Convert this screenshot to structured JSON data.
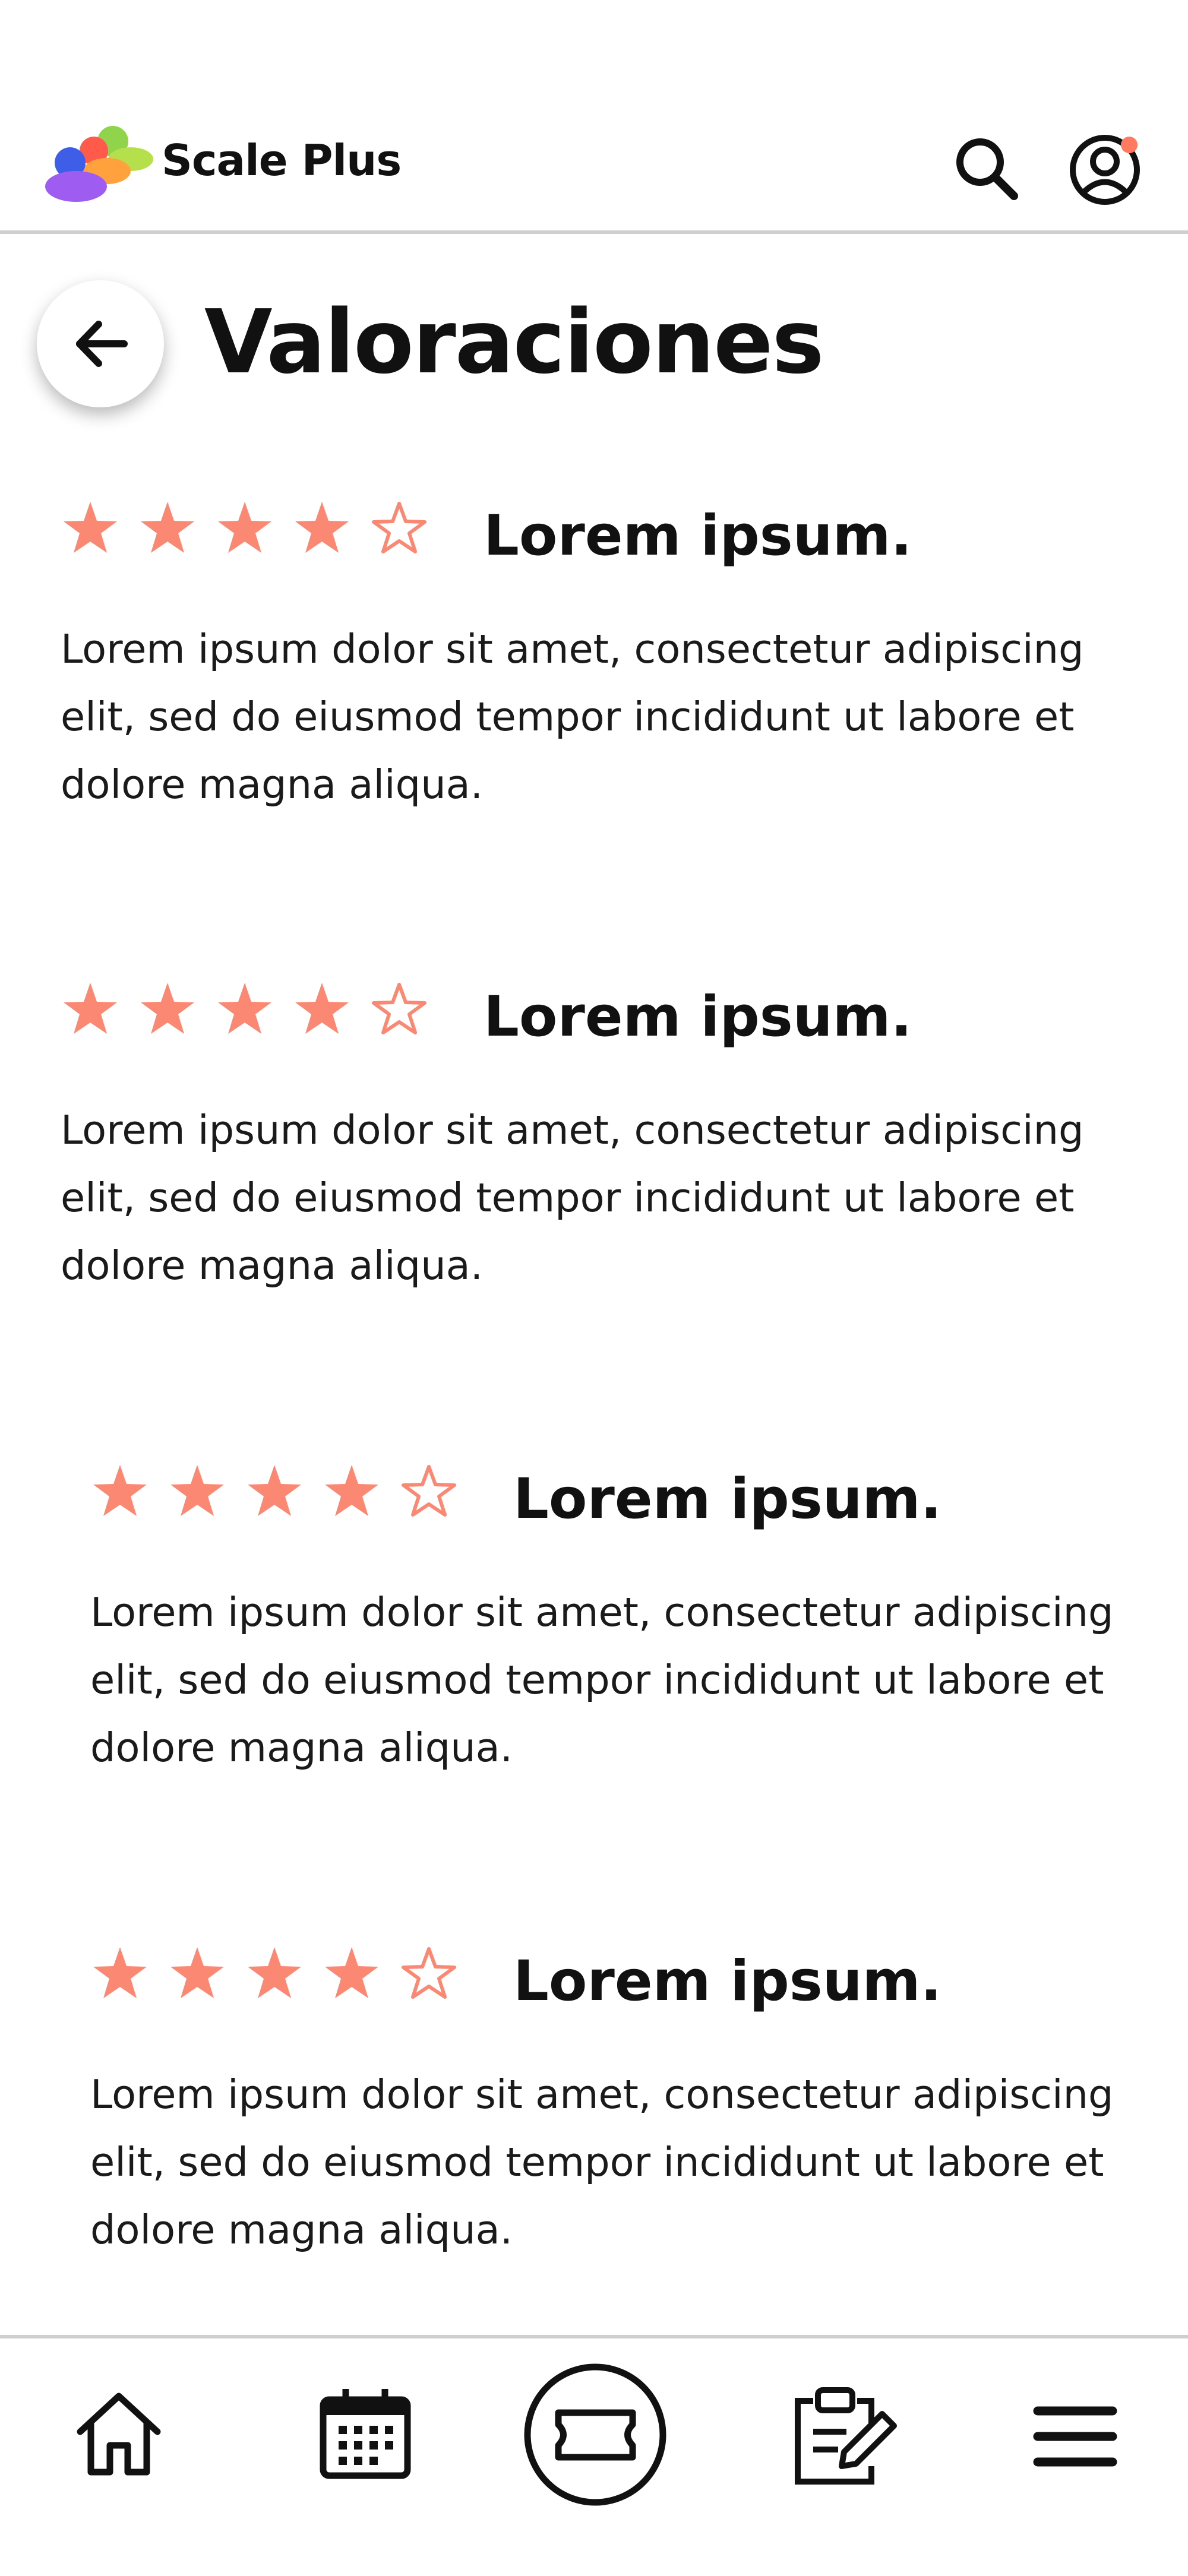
{
  "header": {
    "app_name": "Scale Plus",
    "icons": [
      "logo-icon",
      "search-icon",
      "user-account-icon"
    ],
    "notification_dot_color": "#ff7a5f"
  },
  "page": {
    "title": "Valoraciones",
    "back_icon": "arrow-left-icon"
  },
  "reviews": [
    {
      "rating": 4,
      "max_rating": 5,
      "title": "Lorem ipsum.",
      "body": "Lorem ipsum dolor sit amet, consectetur adipiscing elit, sed do eiusmod tempor incididunt ut labore et dolore magna aliqua."
    },
    {
      "rating": 4,
      "max_rating": 5,
      "title": "Lorem ipsum.",
      "body": "Lorem ipsum dolor sit amet, consectetur adipiscing elit, sed do eiusmod tempor incididunt ut labore et dolore magna aliqua."
    },
    {
      "rating": 4,
      "max_rating": 5,
      "title": "Lorem ipsum.",
      "body": "Lorem ipsum dolor sit amet, consectetur adipiscing elit, sed do eiusmod tempor incididunt ut labore et dolore magna aliqua."
    },
    {
      "rating": 4,
      "max_rating": 5,
      "title": "Lorem ipsum.",
      "body": "Lorem ipsum dolor sit amet, consectetur adipiscing elit, sed do eiusmod tempor incididunt ut labore et dolore magna aliqua."
    }
  ],
  "bottom_nav": {
    "items": [
      "home-icon",
      "calendar-icon",
      "ticket-icon",
      "clipboard-edit-icon",
      "menu-icon"
    ],
    "active_item": "ticket-icon"
  },
  "colors": {
    "star": "#fa8873",
    "text": "#111111",
    "divider": "#cfcfcf"
  }
}
